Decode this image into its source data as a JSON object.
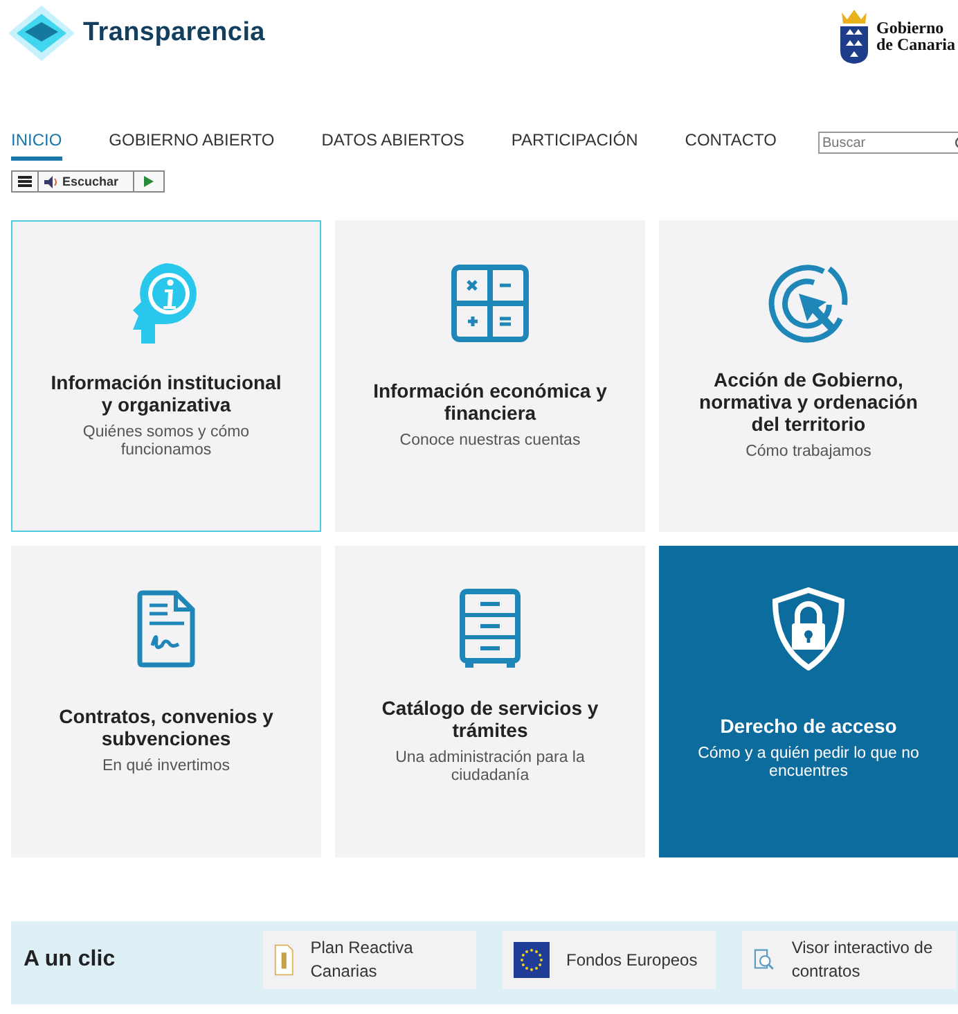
{
  "header": {
    "title": "Transparencia",
    "gov_line1": "Gobierno",
    "gov_line2": "de Canaria"
  },
  "nav": [
    {
      "label": "INICIO",
      "selected": true
    },
    {
      "label": "GOBIERNO ABIERTO",
      "selected": false
    },
    {
      "label": "DATOS ABIERTOS",
      "selected": false
    },
    {
      "label": "PARTICIPACIÓN",
      "selected": false
    },
    {
      "label": "CONTACTO",
      "selected": false
    }
  ],
  "search": {
    "placeholder": "Buscar"
  },
  "reader": {
    "label": "Escuchar"
  },
  "cards": [
    {
      "title": "Información institucional y organizativa",
      "subtitle": "Quiénes somos y cómo funcionamos",
      "kind": "plain",
      "selected": true
    },
    {
      "title": "Información económica y financiera",
      "subtitle": "Conoce nuestras cuentas",
      "kind": "plain",
      "selected": false
    },
    {
      "title": "Acción de Gobierno, normativa y ordenación del territorio",
      "subtitle": "Cómo trabajamos",
      "kind": "plain",
      "selected": false
    },
    {
      "title": "Contratos, convenios y subvenciones",
      "subtitle": "En qué invertimos",
      "kind": "plain",
      "selected": false
    },
    {
      "title": "Catálogo de servicios y trámites",
      "subtitle": "Una administración para la ciudadanía",
      "kind": "plain",
      "selected": false
    },
    {
      "title": "Derecho de acceso",
      "subtitle": "Cómo y a quién pedir lo que no encuentres",
      "kind": "featured",
      "selected": false
    }
  ],
  "quick_links": {
    "title": "A un clic",
    "items": [
      {
        "label": "Plan Reactiva Canarias"
      },
      {
        "label": "Fondos Europeos"
      },
      {
        "label": "Visor interactivo de contratos"
      }
    ]
  }
}
